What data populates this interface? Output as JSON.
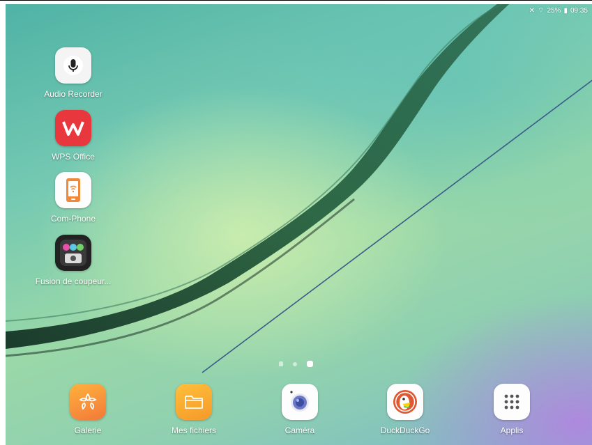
{
  "status_bar": {
    "battery": "25%",
    "time": "09:35",
    "icons": [
      "mute-icon",
      "wifi-icon",
      "battery-icon"
    ]
  },
  "desktop_apps": [
    {
      "label": "Audio Recorder",
      "icon": "microphone-icon"
    },
    {
      "label": "WPS Office",
      "icon": "wps-logo-icon"
    },
    {
      "label": "Com-Phone",
      "icon": "phone-wifi-icon"
    },
    {
      "label": "Fusion de coupeur...",
      "icon": "music-mixer-icon"
    }
  ],
  "page_indicator": {
    "pages": 3,
    "active": 3
  },
  "dock": [
    {
      "label": "Galerie",
      "icon": "gallery-flower-icon"
    },
    {
      "label": "Mes fichiers",
      "icon": "folder-icon"
    },
    {
      "label": "Caméra",
      "icon": "camera-icon"
    },
    {
      "label": "DuckDuckGo",
      "icon": "duckduckgo-icon"
    },
    {
      "label": "Applis",
      "icon": "apps-grid-icon"
    }
  ],
  "colors": {
    "galerie": "#f6963a",
    "mes_fichiers": "#f6a531",
    "wps": "#e8383d",
    "com_phone": "#f08a3a"
  }
}
